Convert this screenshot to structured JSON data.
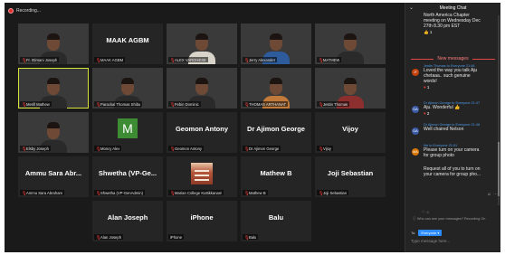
{
  "recording": {
    "label": "Recording..."
  },
  "tiles": [
    {
      "name": "Fr. Ittimani Joseph",
      "display": "",
      "bg": "bg-a",
      "person": "dark"
    },
    {
      "name": "MAAK AGBM",
      "display": "MAAK AGBM",
      "bg": "",
      "person": ""
    },
    {
      "name": "ALEX VARGHESE",
      "display": "",
      "bg": "bg-b",
      "person": "light"
    },
    {
      "name": "Jerry Alexander",
      "display": "",
      "bg": "bg-c",
      "person": "blue"
    },
    {
      "name": "MATHEW",
      "display": "",
      "bg": "bg-d",
      "person": "dark"
    },
    {
      "name": "Merill Mathew",
      "display": "",
      "bg": "bg-k",
      "person": "dark",
      "speaking": true
    },
    {
      "name": "Parackal Thomas Shibu",
      "display": "",
      "bg": "bg-f",
      "person": "dark"
    },
    {
      "name": "Febin Dominic",
      "display": "",
      "bg": "bg-g",
      "person": "dark"
    },
    {
      "name": "THOMAS ARTHANAT",
      "display": "",
      "bg": "bg-h",
      "person": "orange"
    },
    {
      "name": "Jestin Thomas",
      "display": "",
      "bg": "bg-j",
      "person": "red"
    },
    {
      "name": "Elsby Joseph",
      "display": "",
      "bg": "bg-e",
      "person": "dark"
    },
    {
      "name": "Moncy Alex",
      "display": "",
      "bg": "",
      "person": "",
      "avatar": "M"
    },
    {
      "name": "Geomon Antony",
      "display": "Geomon Antony",
      "bg": "",
      "person": ""
    },
    {
      "name": "Dr Ajimon George",
      "display": "Dr Ajimon George",
      "bg": "",
      "person": ""
    },
    {
      "name": "Vijoy",
      "display": "Vijoy",
      "bg": "",
      "person": ""
    },
    {
      "name": "Ammu Sara Abraham",
      "display": "Ammu Sara Abr...",
      "bg": "",
      "person": ""
    },
    {
      "name": "Shwetha (VP-GenAdmin)",
      "display": "Shwetha (VP-Ge...",
      "bg": "",
      "person": ""
    },
    {
      "name": "Marian College Kuttikkanam",
      "display": "",
      "bg": "",
      "person": "",
      "image": true
    },
    {
      "name": "Mathew B",
      "display": "Mathew B",
      "bg": "",
      "person": ""
    },
    {
      "name": "Joji Sebastian",
      "display": "Joji Sebastian",
      "bg": "",
      "person": ""
    },
    {
      "name": "Alan Joseph",
      "display": "Alan Joseph",
      "bg": "",
      "person": ""
    },
    {
      "name": "iPhone",
      "display": "iPhone",
      "bg": "",
      "person": "",
      "no_mic": true
    },
    {
      "name": "Balu",
      "display": "Balu",
      "bg": "",
      "person": ""
    }
  ],
  "chat": {
    "title": "Meeting Chat",
    "top_message": [
      "North America Chapter",
      "meeting on Wednesday Dec",
      "27th 8.30 pm EST"
    ],
    "top_reaction": "1",
    "new_messages_label": "New messages",
    "messages": [
      {
        "head": "Jestin Thomas to Everyone 21:46",
        "avatar": "JT",
        "avatar_color": "#c2410c",
        "lines": [
          "Loved the way you talk Aju",
          "chetaaa.. such genuine",
          "words!"
        ],
        "reaction": "heart",
        "count": "1"
      },
      {
        "head": "Dr Ajimon George to Everyone 21:47",
        "avatar": "DA",
        "avatar_color": "#3b5aa8",
        "lines": [
          "Aju. Wonderful"
        ],
        "reaction": "heart",
        "count": "2",
        "thumb": true
      },
      {
        "head": "Dr Ajimon George to Everyone 21:48",
        "avatar": "DA",
        "avatar_color": "#3b5aa8",
        "lines": [
          "Well chaired Nelson"
        ],
        "reaction": "",
        "count": ""
      },
      {
        "head": "Me to Everyone 21:51",
        "avatar": "MA",
        "avatar_color": "#d97706",
        "lines": [
          "Please turn on your camera",
          "for group photo"
        ],
        "reaction": "",
        "count": ""
      },
      {
        "head": "",
        "avatar": "",
        "avatar_color": "",
        "lines": [
          "Request all of you to turn on",
          "your camera for group pho..."
        ],
        "reaction": "",
        "count": ""
      }
    ],
    "who_can_see": "Who can see your messages? Recording On",
    "to_label": "To:",
    "to_value": "Everyone",
    "placeholder": "Type message here..."
  }
}
